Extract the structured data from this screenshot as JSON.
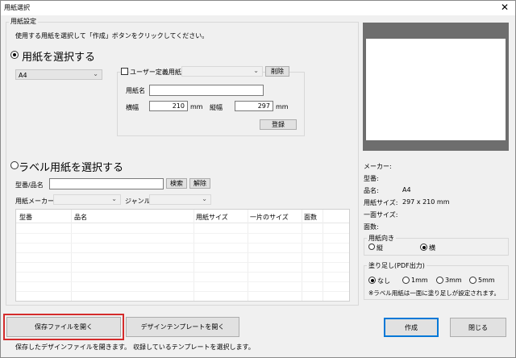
{
  "window": {
    "title": "用紙選択",
    "close_glyph": "✕"
  },
  "settings_group": {
    "label": "用紙設定",
    "instruction": "使用する用紙を選択して「作成」ボタンをクリックしてください。"
  },
  "paper_option": {
    "label": "用紙を選択する",
    "size_select": "A4",
    "user_defined_label": "ユーザー定義用紙",
    "delete_button": "削除",
    "name_label": "用紙名",
    "name_value": "",
    "width_label": "横幅",
    "width_value": "210",
    "width_unit": "mm",
    "height_label": "縦幅",
    "height_value": "297",
    "height_unit": "mm",
    "register_button": "登録"
  },
  "label_option": {
    "label": "ラベル用紙を選択する",
    "model_label": "型番/品名",
    "search_button": "検索",
    "clear_button": "解除",
    "maker_label": "用紙メーカー",
    "genre_label": "ジャンル",
    "table_headers": [
      "型番",
      "品名",
      "用紙サイズ",
      "一片のサイズ",
      "面数"
    ]
  },
  "info": {
    "maker_label": "メーカー:",
    "model_label": "型番:",
    "name_label": "品名:",
    "name_value": "A4",
    "size_label": "用紙サイズ:",
    "size_value": "297 x 210 mm",
    "piece_label": "一面サイズ:",
    "faces_label": "面数:"
  },
  "orientation": {
    "label": "用紙向き",
    "portrait": "縦",
    "landscape": "横"
  },
  "bleed": {
    "label": "塗り足し(PDF出力)",
    "none": "なし",
    "opt1": "1mm",
    "opt3": "3mm",
    "opt5": "5mm",
    "note": "※ラベル用紙は一面に塗り足しが設定されます。"
  },
  "footer": {
    "open_saved_button": "保存ファイルを開く",
    "open_saved_caption": "保存したデザインファイルを開きます。",
    "open_template_button": "デザインテンプレートを開く",
    "open_template_caption": "収録しているテンプレートを選択します。",
    "create_button": "作成",
    "close_button": "閉じる"
  }
}
